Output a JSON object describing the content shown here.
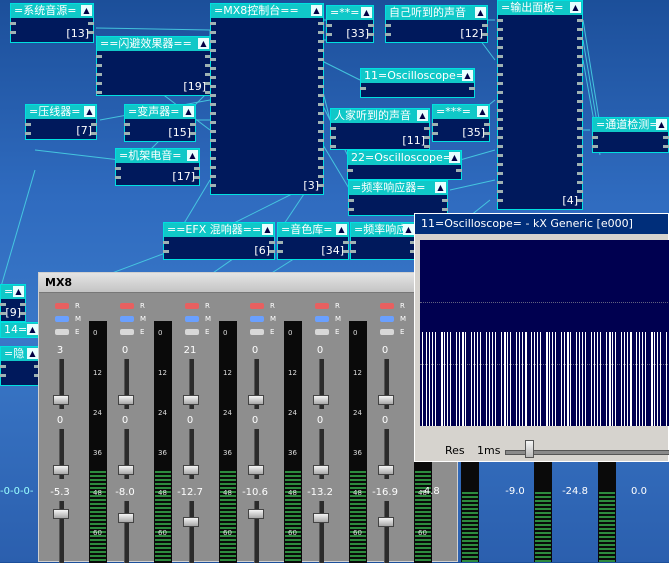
{
  "modules": [
    {
      "title": "=系统音源=",
      "num": "[13]"
    },
    {
      "title": "==闪避效果器==",
      "num": "[19]"
    },
    {
      "title": "=MX8控制台==",
      "num": "[3]"
    },
    {
      "title": "=**=",
      "num": "[33]"
    },
    {
      "title": "自己听到的声音",
      "num": "[12]"
    },
    {
      "title": "=输出面板=",
      "num": "[4]"
    },
    {
      "title": "11=Oscilloscope=",
      "num": ""
    },
    {
      "title": "人家听到的声音",
      "num": "[11]"
    },
    {
      "title": "=***=",
      "num": "[35]"
    },
    {
      "title": "=压线器=",
      "num": "[7]"
    },
    {
      "title": "=变声器=",
      "num": "[15]"
    },
    {
      "title": "=机架电音=",
      "num": "[17]"
    },
    {
      "title": "22=Oscilloscope=",
      "num": ""
    },
    {
      "title": "=频率响应器=",
      "num": ""
    },
    {
      "title": "=通道检测=",
      "num": ""
    },
    {
      "title": "==EFX 混响器==",
      "num": "[6]"
    },
    {
      "title": "=音色库=",
      "num": "[34]"
    },
    {
      "title": "=频率响应",
      "num": ""
    },
    {
      "title": "=",
      "num": "[9]"
    },
    {
      "title": "14===",
      "num": ""
    },
    {
      "title": "=隐",
      "num": ""
    }
  ],
  "side_text": "-0-0-0-",
  "mixer": {
    "title": "MX8",
    "buttons": {
      "r": "R",
      "m": "M",
      "e": "E"
    },
    "meter_labels": [
      "0",
      "12",
      "24",
      "36",
      "48",
      "60"
    ],
    "strips": [
      {
        "top": "3",
        "mid": "0",
        "db": "-5.3"
      },
      {
        "top": "0",
        "mid": "0",
        "db": "-8.0"
      },
      {
        "top": "21",
        "mid": "0",
        "db": "-12.7"
      },
      {
        "top": "0",
        "mid": "0",
        "db": "-10.6"
      },
      {
        "top": "0",
        "mid": "0",
        "db": "-13.2"
      },
      {
        "top": "0",
        "mid": "0",
        "db": "-16.9"
      }
    ],
    "extra_db": [
      "-4.8",
      "-9.0",
      "-24.8",
      "0.0"
    ]
  },
  "oscilloscope": {
    "title": "11=Oscilloscope= - kX Generic [e000]",
    "res_label": "Res",
    "res_value": "1ms"
  }
}
